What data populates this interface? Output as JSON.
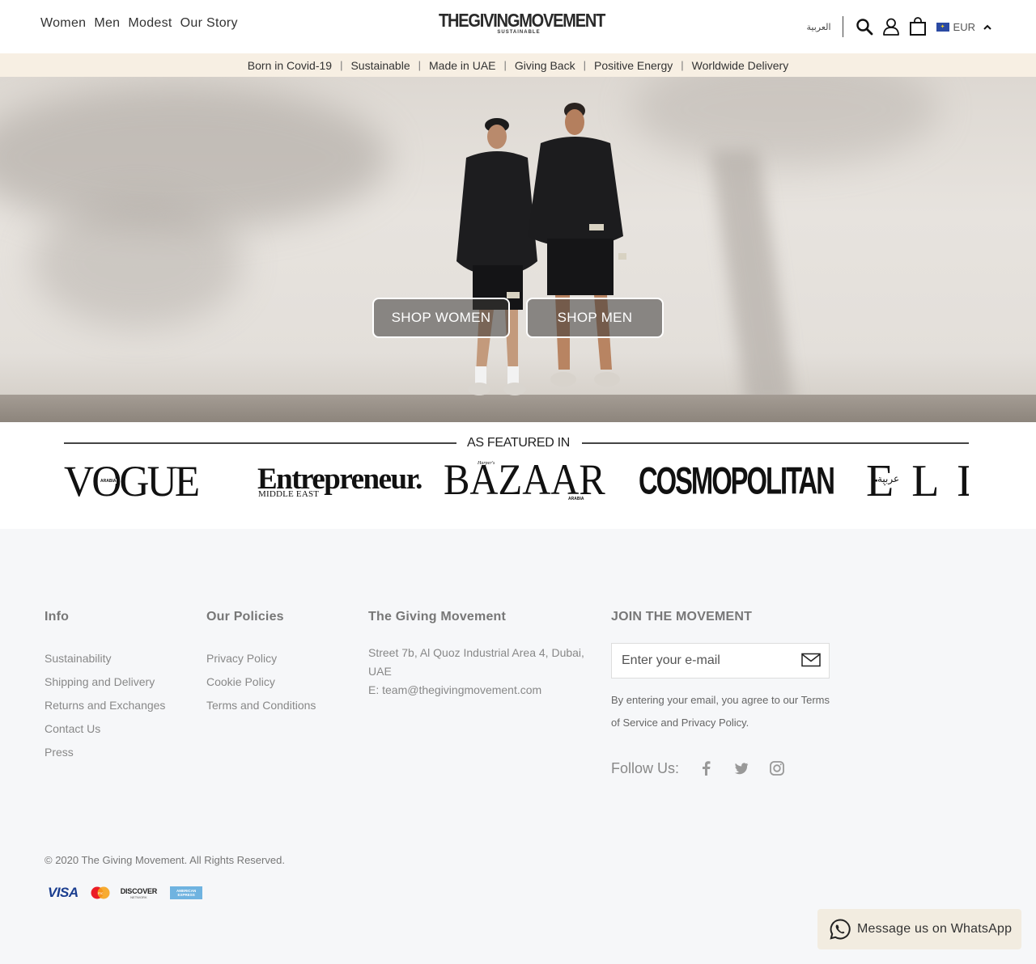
{
  "header": {
    "nav": [
      "Women",
      "Men",
      "Modest",
      "Our Story"
    ],
    "logo_main": "THEGIVINGMOVEMENT",
    "logo_sub": "SUSTAINABLE",
    "arabic_label": "العربية",
    "icons": [
      "search-icon",
      "account-icon",
      "cart-icon"
    ],
    "currency": "EUR",
    "currency_flag": "eu-flag-icon"
  },
  "usp_bar": {
    "items": [
      "Born in Covid-19",
      "Sustainable",
      "Made in UAE",
      "Giving Back",
      "Positive Energy",
      "Worldwide Delivery"
    ],
    "separator": "|"
  },
  "hero": {
    "shop_women": "SHOP WOMEN",
    "shop_men": "SHOP MEN"
  },
  "featured": {
    "title": "AS FEATURED IN",
    "magazines": {
      "vogue": "VOGUE",
      "vogue_sub": "ARABIA",
      "entrepreneur": "Entrepreneur.",
      "entrepreneur_sub": "MIDDLE EAST",
      "bazaar": "BAZAAR",
      "bazaar_pre": "Harper's",
      "bazaar_sub": "ARABIA",
      "cosmopolitan": "COSMOPOLITAN",
      "elle": "ELLE",
      "elle_sub": "عربية"
    }
  },
  "footer": {
    "info": {
      "title": "Info",
      "links": [
        "Sustainability",
        "Shipping and Delivery",
        "Returns and Exchanges",
        "Contact Us",
        "Press"
      ]
    },
    "policies": {
      "title": "Our Policies",
      "links": [
        "Privacy Policy",
        "Cookie Policy",
        "Terms and Conditions"
      ]
    },
    "company": {
      "title": "The Giving Movement",
      "address_line1": "Street 7b, Al Quoz Industrial Area 4, Dubai,",
      "address_line2": "UAE",
      "email": "E: team@thegivingmovement.com"
    },
    "newsletter": {
      "title": "JOIN THE MOVEMENT",
      "placeholder": "Enter your e-mail",
      "consent": "By entering your email, you agree to our Terms of Service and Privacy Policy."
    },
    "follow_label": "Follow Us:",
    "social": [
      "facebook-icon",
      "twitter-icon",
      "instagram-icon"
    ],
    "copyright": "© 2020 The Giving Movement. All Rights Reserved.",
    "payments": {
      "visa": "VISA",
      "discover": "DISCOVER",
      "discover_sub": "NETWORK",
      "amex": "AMERICAN EXPRESS"
    }
  },
  "whatsapp": {
    "label": "Message us on WhatsApp"
  }
}
